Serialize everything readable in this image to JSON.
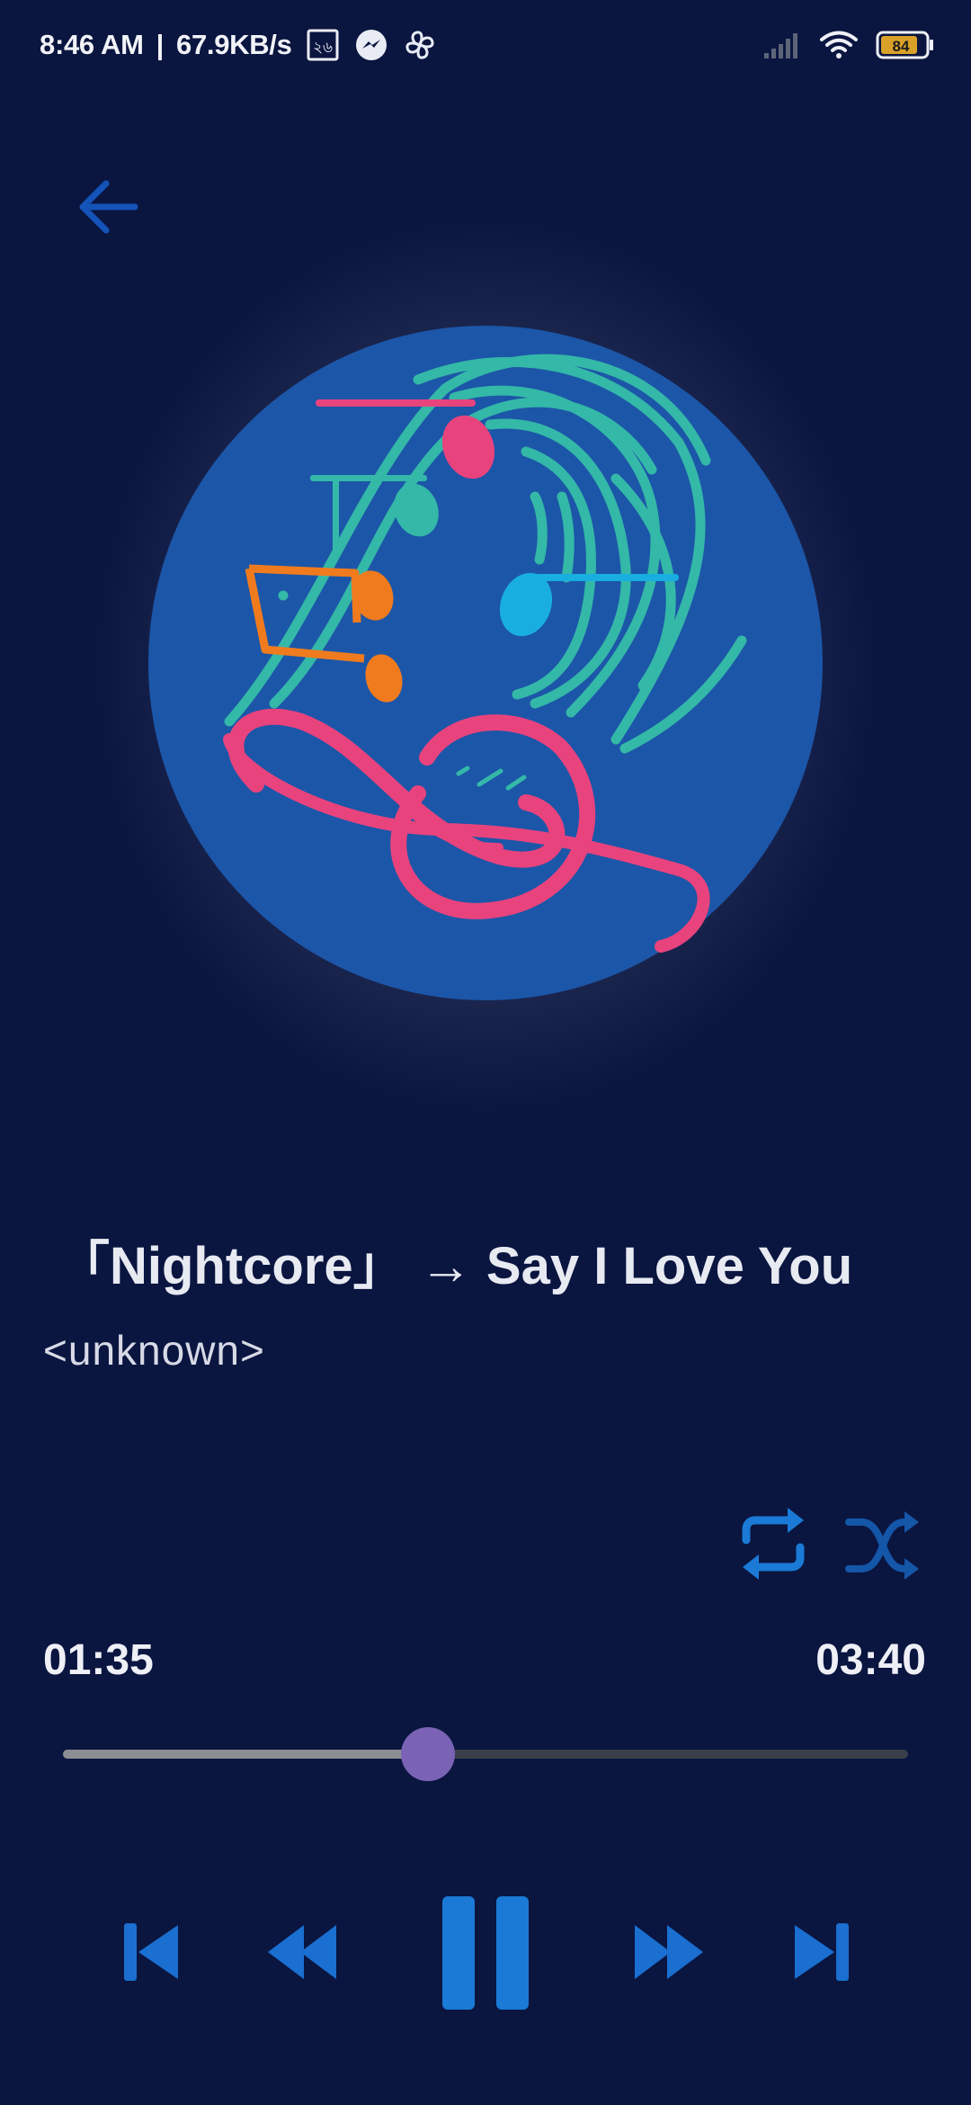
{
  "status_bar": {
    "time": "8:46 AM",
    "speed": "67.9KB/s",
    "notification_badge": "২৬",
    "battery_level": "84"
  },
  "track": {
    "title": "「Nightcore」 → Say I Love You",
    "artist": "<unknown>"
  },
  "playback": {
    "current_time": "01:35",
    "total_time": "03:40",
    "progress_fraction": 0.432
  },
  "icons": {
    "back": "arrow-left-icon",
    "repeat": "repeat-icon",
    "shuffle": "shuffle-icon",
    "skip_previous": "skip-previous-icon",
    "rewind": "rewind-icon",
    "pause": "pause-icon",
    "fast_forward": "fast-forward-icon",
    "skip_next": "skip-next-icon"
  },
  "colors": {
    "background": "#0a1540",
    "accent_blue": "#1a7ad6",
    "seek_thumb": "#7a63b5",
    "album_circle": "#1c56a8"
  }
}
